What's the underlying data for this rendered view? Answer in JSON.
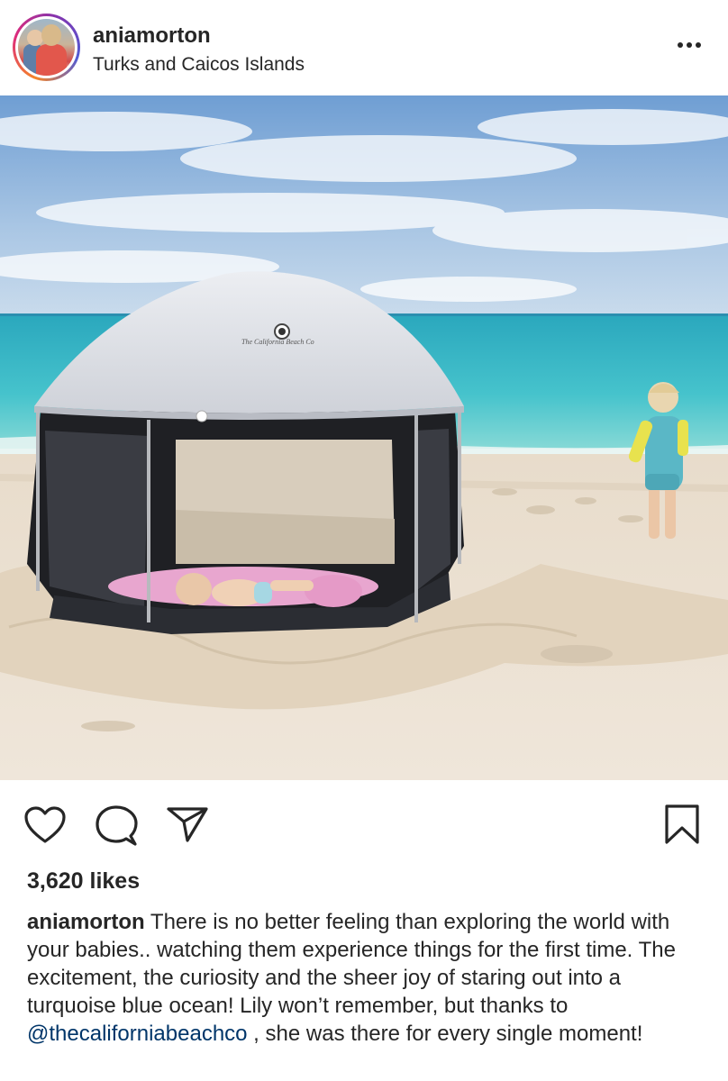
{
  "post": {
    "username": "aniamorton",
    "location": "Turks and Caicos Islands",
    "likes": "3,620 likes",
    "caption_user": "aniamorton",
    "caption_text_before": " There is no better feeling than exploring the world with your babies.. watching them experience things for the first time.  The excitement, the curiosity and the sheer joy of staring out into a turquoise blue ocean! Lily won’t remember, but thanks to ",
    "caption_mention": "@thecaliforniabeachco",
    "caption_text_after": " , she was there for every single moment!"
  },
  "photo": {
    "tent_brand_text": "The California Beach Co"
  },
  "icons": {
    "more": "more-options-icon",
    "like": "heart-icon",
    "comment": "comment-icon",
    "share": "share-icon",
    "save": "bookmark-icon"
  },
  "colors": {
    "text": "#262626",
    "mention": "#003569",
    "ocean": "#3fb8c6",
    "sand": "#e9ddcb",
    "sky": "#7ea9d6"
  }
}
